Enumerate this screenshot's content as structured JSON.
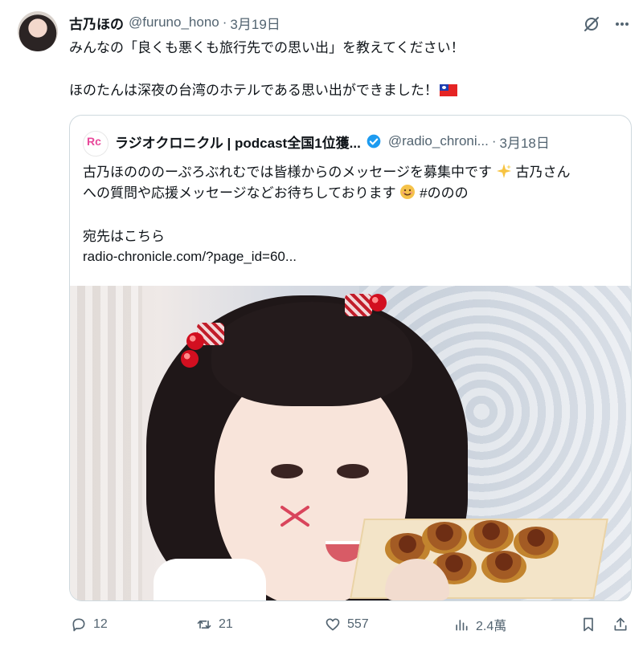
{
  "tweet": {
    "display_name": "古乃ほの",
    "handle": "@furuno_hono",
    "separator": "·",
    "date": "3月19日",
    "text_line1": "みんなの「良くも悪くも旅行先での思い出」を教えてください！",
    "text_line2": "ほのたんは深夜の台湾のホテルである思い出ができました！"
  },
  "quote": {
    "avatar_text": "Rc",
    "display_name": "ラジオクロニクル | podcast全国1位獲...",
    "handle": "@radio_chroni...",
    "separator": "·",
    "date": "3月18日",
    "line1": "古乃ほのののーぷろぶれむでは皆様からのメッセージを募集中です",
    "line1_end": "古乃さん",
    "line2": "への質問や応援メッセージなどお待ちしております",
    "line2_end": "#ののの",
    "line3": "宛先はこちら",
    "line4": "radio-chronicle.com/?page_id=60..."
  },
  "actions": {
    "reply_count": "12",
    "retweet_count": "21",
    "like_count": "557",
    "views_count": "2.4萬"
  },
  "icons": {
    "grok": "grok-icon",
    "more": "more-icon",
    "verified": "verified-icon",
    "reply": "reply-icon",
    "retweet": "retweet-icon",
    "like": "like-icon",
    "views": "views-icon",
    "bookmark": "bookmark-icon",
    "share": "share-icon"
  },
  "colors": {
    "text": "#0f1419",
    "secondary": "#536471",
    "border": "#cfd9de",
    "verified": "#1d9bf0"
  }
}
